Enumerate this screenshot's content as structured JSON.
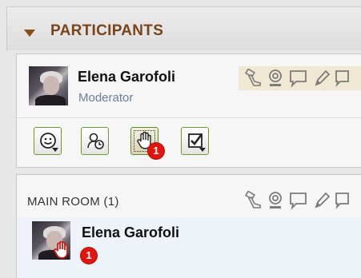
{
  "header": {
    "title": "PARTICIPANTS"
  },
  "moderator": {
    "name": "Elena Garofoli",
    "role": "Moderator",
    "status_icons": [
      "presenter-icon",
      "webcam-icon",
      "chat-icon",
      "pencil-icon",
      "more-icon"
    ]
  },
  "toolbar": {
    "buttons": [
      {
        "name": "emoticon-icon",
        "has_menu": true
      },
      {
        "name": "step-away-icon",
        "has_menu": false
      },
      {
        "name": "raise-hand-icon",
        "has_menu": false,
        "active": true,
        "badge": "1"
      },
      {
        "name": "poll-icon",
        "has_menu": true
      }
    ]
  },
  "room": {
    "title": "MAIN ROOM (1)",
    "status_icons": [
      "presenter-icon",
      "webcam-icon",
      "chat-icon",
      "pencil-icon",
      "more-icon"
    ],
    "participants": [
      {
        "name": "Elena Garofoli",
        "badge": "1"
      }
    ]
  },
  "colors": {
    "header_text": "#7a4418",
    "role_text": "#6b7f9a",
    "badge": "#e1150e",
    "button_border": "#6d9b2e",
    "row_highlight": "#eef3fa"
  }
}
